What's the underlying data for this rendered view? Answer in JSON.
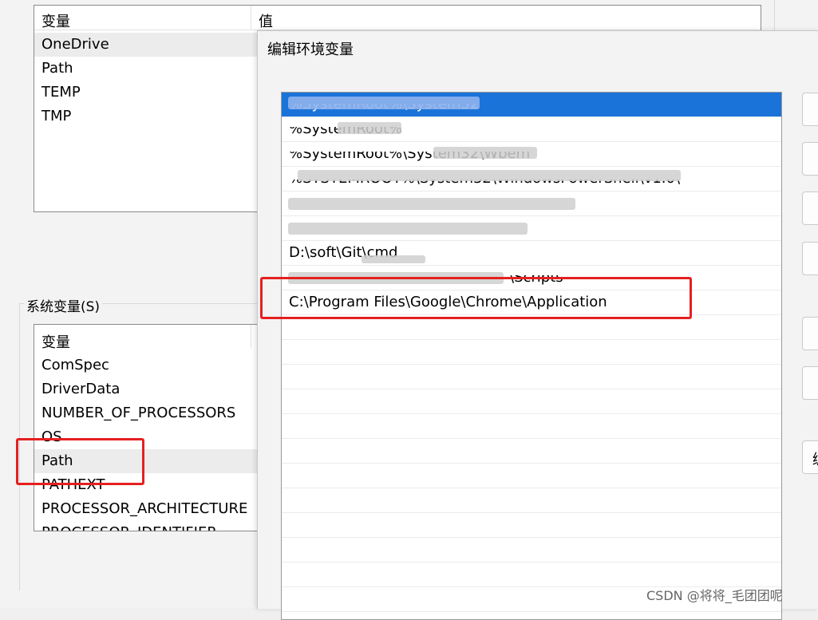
{
  "user_vars": {
    "header_variable": "变量",
    "header_value": "值",
    "rows": [
      "OneDrive",
      "Path",
      "TEMP",
      "TMP"
    ]
  },
  "system_vars": {
    "group_title": "系统变量(S)",
    "header_variable": "变量",
    "rows": [
      "ComSpec",
      "DriverData",
      "NUMBER_OF_PROCESSORS",
      "OS",
      "Path",
      "PATHEXT",
      "PROCESSOR_ARCHITECTURE",
      "PROCESSOR_IDENTIFIER"
    ]
  },
  "edit_dialog": {
    "title": "编辑环境变量",
    "entries": {
      "e0": "%SystemRoot%\\System32",
      "e1": "%SystemRoot%",
      "e2": "%SystemRoot%\\System32\\Wbem",
      "e3": "%SYSTEMROOT%\\System32\\WindowsPowerShell\\v1.0\\",
      "e6": "D:\\soft\\Git\\cmd",
      "e7": "\\Scripts",
      "e8": "C:\\Program Files\\Google\\Chrome\\Application"
    },
    "side_button_partial": "编"
  },
  "watermark": "CSDN @将将_毛团团呢"
}
